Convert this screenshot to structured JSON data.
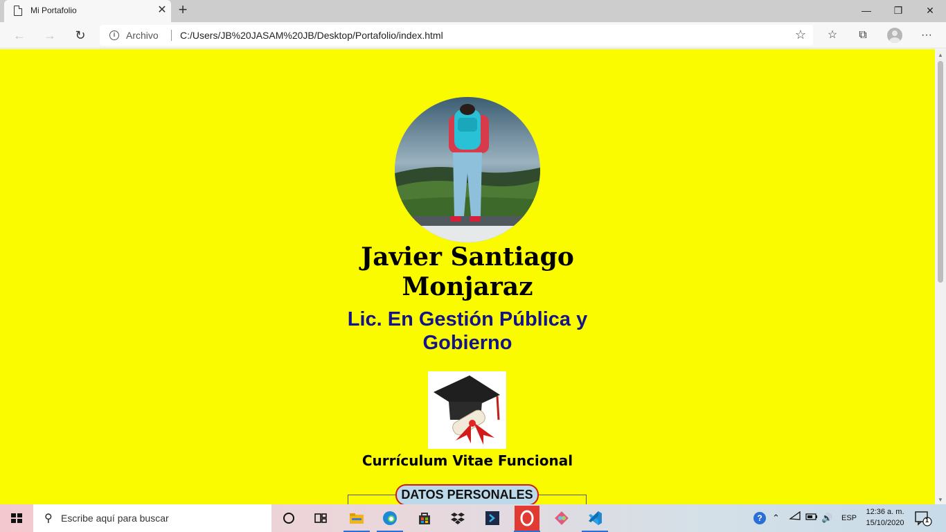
{
  "browser": {
    "tab_title": "Mi Portafolio",
    "tab_close": "✕",
    "new_tab": "+",
    "site_label": "Archivo",
    "url": "C:/Users/JB%20JASAM%20JB/Desktop/Portafolio/index.html",
    "window_controls": {
      "minimize": "—",
      "restore": "❐",
      "close": "✕"
    },
    "icons": [
      "back-icon",
      "forward-icon",
      "refresh-icon",
      "info-icon",
      "favorite-star-icon",
      "favorites-list-icon",
      "collections-icon",
      "profile-icon",
      "more-icon"
    ]
  },
  "page": {
    "name": "Javier Santiago Monjaraz",
    "degree": "Lic. En Gestión Pública y Gobierno",
    "cv_title": "Currículum Vitae Funcional",
    "section_legend": "DATOS PERSONALES"
  },
  "taskbar": {
    "search_placeholder": "Escribe aquí para buscar",
    "language": "ESP",
    "time": "12:36 a. m.",
    "date": "15/10/2020",
    "notification_count": "1",
    "apps": [
      "cortana-icon",
      "task-view-icon",
      "file-explorer-icon",
      "edge-icon",
      "store-icon",
      "dropbox-icon",
      "powershell-icon",
      "opera-icon",
      "git-icon",
      "vscode-icon"
    ]
  },
  "colors": {
    "page_background": "#fbfb00",
    "degree_text": "#141488",
    "legend_fill": "#bcd9ea",
    "legend_border": "#cc1b1b"
  }
}
